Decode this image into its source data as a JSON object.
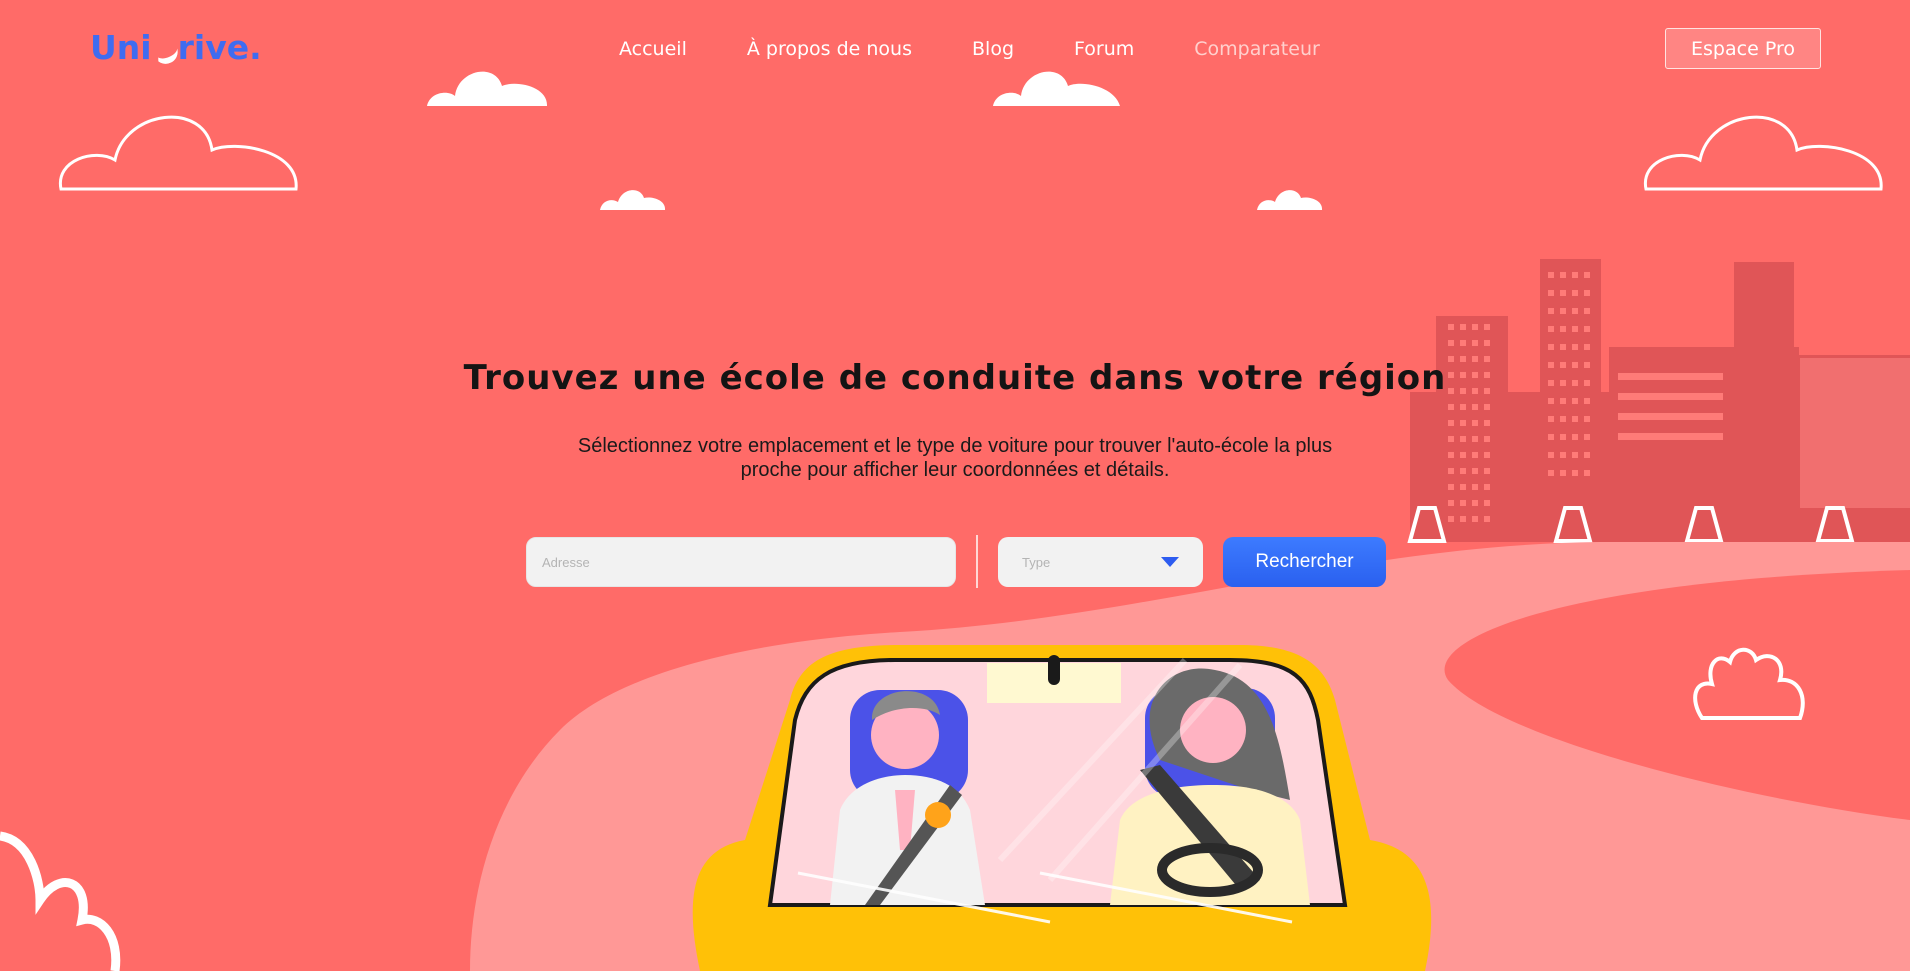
{
  "brand": {
    "name_part1": "Uni",
    "name_part2": "rive.",
    "brand_color": "#3f6cf0"
  },
  "nav": {
    "items": [
      {
        "label": "Accueil"
      },
      {
        "label": "À propos de nous"
      },
      {
        "label": "Blog"
      },
      {
        "label": "Forum"
      },
      {
        "label": "Comparateur"
      }
    ],
    "pro_button": "Espace Pro"
  },
  "hero": {
    "title": "Trouvez une école de conduite dans votre région",
    "subtitle": "Sélectionnez votre emplacement et le type de voiture pour trouver l'auto-école la plus proche pour afficher leur coordonnées et détails."
  },
  "search": {
    "address_placeholder": "Adresse",
    "type_placeholder": "Type",
    "button": "Rechercher"
  },
  "colors": {
    "background": "#ff6b68",
    "road": "#ff9896",
    "buildings": "#e05557",
    "car": "#ffc107",
    "button": "#2d63f2"
  },
  "icons": [
    "cloud-icon",
    "dropdown-caret-icon",
    "traffic-cone-icon",
    "bush-icon"
  ]
}
